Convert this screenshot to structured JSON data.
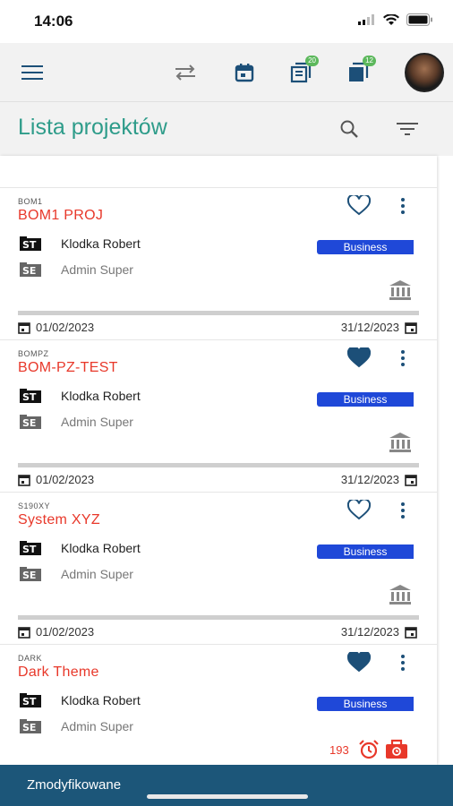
{
  "status_bar": {
    "time": "14:06"
  },
  "toolbar": {
    "icons": [
      "menu-icon",
      "swap-icon",
      "calendar-icon",
      "layers-icon",
      "layers-filled-icon",
      "avatar"
    ],
    "badge_1": "20",
    "badge_2": "12"
  },
  "header": {
    "title": "Lista projektów"
  },
  "projects": [
    {
      "code": "BOM1",
      "name": "BOM1 PROJ",
      "owner": "Klodka Robert",
      "admin": "Admin Super",
      "tag": "Business",
      "favorite": false,
      "start": "01/02/2023",
      "end": "31/12/2023"
    },
    {
      "code": "BOMPZ",
      "name": "BOM-PZ-TEST",
      "owner": "Klodka Robert",
      "admin": "Admin Super",
      "tag": "Business",
      "favorite": true,
      "start": "01/02/2023",
      "end": "31/12/2023"
    },
    {
      "code": "S190XY",
      "name": "System XYZ",
      "owner": "Klodka Robert",
      "admin": "Admin Super",
      "tag": "Business",
      "favorite": false,
      "start": "01/02/2023",
      "end": "31/12/2023"
    },
    {
      "code": "DARK",
      "name": "Dark Theme",
      "owner": "Klodka Robert",
      "admin": "Admin Super",
      "tag": "Business",
      "favorite": true,
      "alert_count": "193"
    }
  ],
  "bottom_bar": {
    "label": "Zmodyfikowane"
  },
  "colors": {
    "accent": "#2e9c8a",
    "project_name": "#e8382a",
    "tag": "#1f48d8",
    "bottom_bar": "#1c5679",
    "heart": "#1c4f78"
  }
}
